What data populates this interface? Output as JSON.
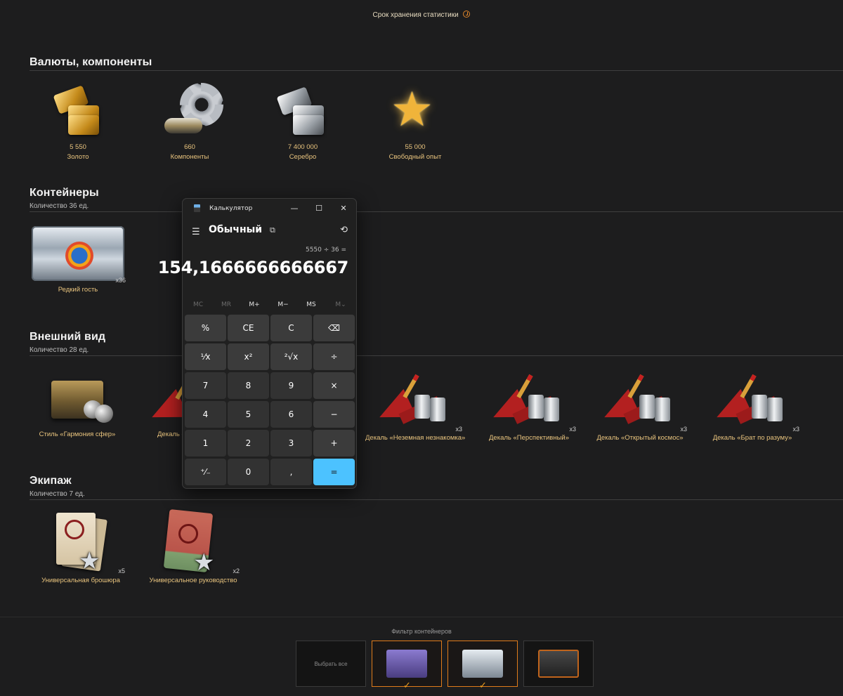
{
  "header": {
    "storage_note": "Срок хранения статистики"
  },
  "currencies": {
    "title": "Валюты, компоненты",
    "items": [
      {
        "value": "5 550",
        "label": "Золото"
      },
      {
        "value": "660",
        "label": "Компоненты"
      },
      {
        "value": "7 400 000",
        "label": "Серебро"
      },
      {
        "value": "55 000",
        "label": "Свободный опыт"
      }
    ]
  },
  "containers": {
    "title": "Контейнеры",
    "count": "Количество 36 ед.",
    "items": [
      {
        "label": "Редкий гость",
        "qty": "x36"
      }
    ]
  },
  "appearance": {
    "title": "Внешний вид",
    "count": "Количество 28 ед.",
    "items": [
      {
        "label": "Стиль «Гармония сфер»",
        "qty": ""
      },
      {
        "label": "Декаль «",
        "qty": ""
      },
      {
        "label": "Декаль «Неземная незнакомка»",
        "qty": "x3"
      },
      {
        "label": "Декаль «Перспективный»",
        "qty": "x3"
      },
      {
        "label": "Декаль «Открытый космос»",
        "qty": "x3"
      },
      {
        "label": "Декаль «Брат по разуму»",
        "qty": "x3"
      }
    ]
  },
  "crew": {
    "title": "Экипаж",
    "count": "Количество 7 ед.",
    "items": [
      {
        "label": "Универсальная брошюра",
        "qty": "x5"
      },
      {
        "label": "Универсальное руководство",
        "qty": "x2"
      }
    ]
  },
  "filter": {
    "title": "Фильтр контейнеров",
    "select_all": "Выбрать все",
    "tiles": [
      {
        "color": "#6a5aa0",
        "selected": true
      },
      {
        "color": "#9aa6b3",
        "selected": true
      },
      {
        "color": "#3a3a3a",
        "selected": false
      }
    ],
    "check": "✓"
  },
  "calculator": {
    "window_title": "Калькулятор",
    "minimize": "—",
    "maximize": "☐",
    "close": "✕",
    "menu_icon": "☰",
    "mode": "Обычный",
    "keep_on_top_icon": "⧉",
    "history_icon": "⟲",
    "expression": "5550 ÷ 36 =",
    "display": "154,1666666666667",
    "memory": [
      "MC",
      "MR",
      "M+",
      "M−",
      "MS",
      "M⌄"
    ],
    "keys": [
      [
        "%",
        "CE",
        "C",
        "⌫"
      ],
      [
        "¹⁄x",
        "x²",
        "²√x",
        "÷"
      ],
      [
        "7",
        "8",
        "9",
        "×"
      ],
      [
        "4",
        "5",
        "6",
        "−"
      ],
      [
        "1",
        "2",
        "3",
        "+"
      ],
      [
        "⁺⁄₋",
        "0",
        ",",
        "="
      ]
    ],
    "accent_color": "#4cc2ff"
  }
}
